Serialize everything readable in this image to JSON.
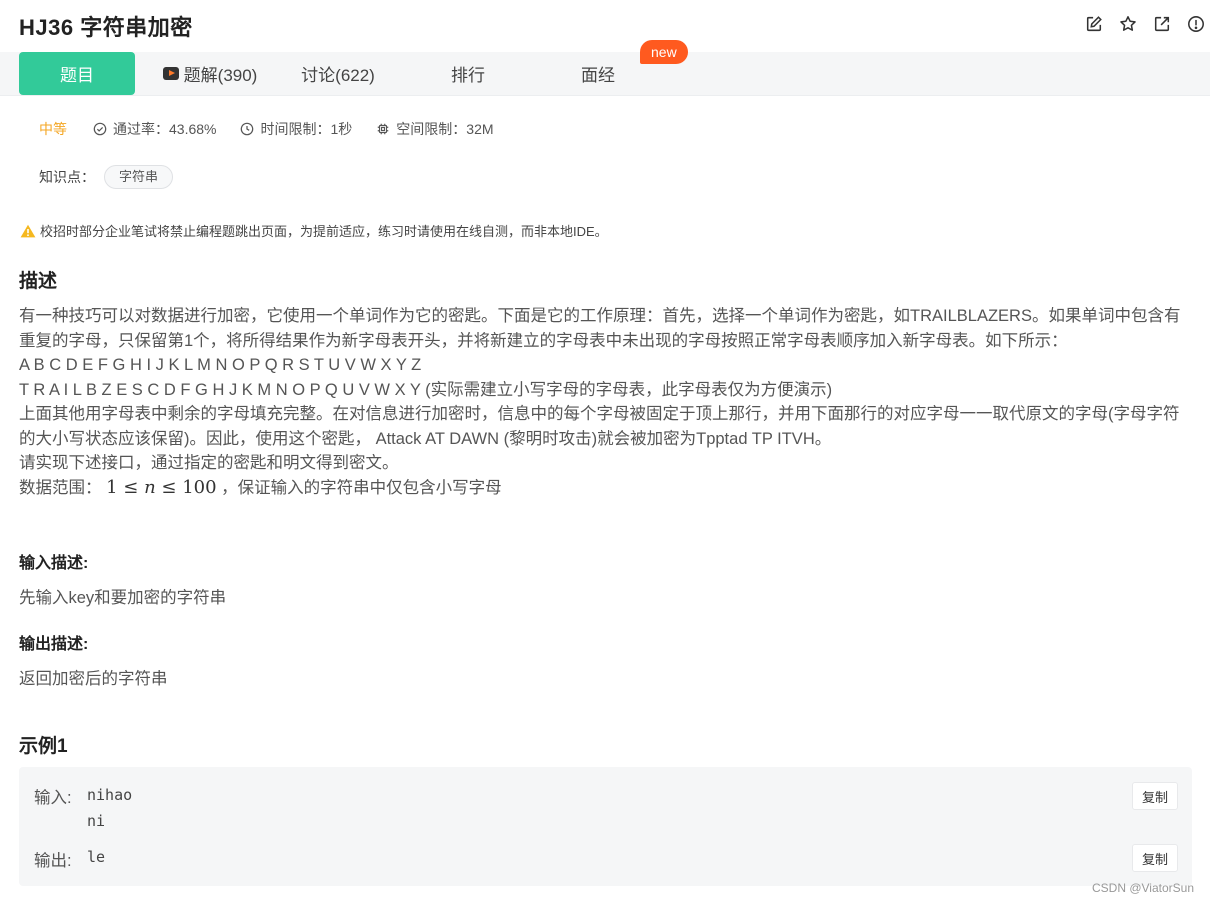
{
  "header": {
    "title": "HJ36  字符串加密"
  },
  "tabs": [
    {
      "label": "题目"
    },
    {
      "label": "题解(390)"
    },
    {
      "label": "讨论(622)"
    },
    {
      "label": "排行"
    },
    {
      "label": "面经"
    }
  ],
  "new_badge": "new",
  "meta": {
    "difficulty": "中等",
    "pass_rate": "通过率：43.68%",
    "time_limit": "时间限制：1秒",
    "space_limit": "空间限制：32M"
  },
  "knowledge": {
    "label": "知识点：",
    "tag": "字符串"
  },
  "warning": "校招时部分企业笔试将禁止编程题跳出页面，为提前适应，练习时请使用在线自测，而非本地IDE。",
  "description": {
    "heading": "描述",
    "para1": "有一种技巧可以对数据进行加密，它使用一个单词作为它的密匙。下面是它的工作原理：首先，选择一个单词作为密匙，如TRAILBLAZERS。如果单词中包含有重复的字母，只保留第1个，将所得结果作为新字母表开头，并将新建立的字母表中未出现的字母按照正常字母表顺序加入新字母表。如下所示：",
    "line_alphabet": "A B C D E F G H I J K L M N O P Q R S T U V W X Y Z",
    "line_cipher": "T R A I L B Z E S C D F G H J K M N O P Q U V W X Y (实际需建立小写字母的字母表，此字母表仅为方便演示)",
    "para2": "上面其他用字母表中剩余的字母填充完整。在对信息进行加密时，信息中的每个字母被固定于顶上那行，并用下面那行的对应字母一一取代原文的字母(字母字符的大小写状态应该保留)。因此，使用这个密匙， Attack AT DAWN (黎明时攻击)就会被加密为Tpptad TP ITVH。",
    "para3": "请实现下述接口，通过指定的密匙和明文得到密文。",
    "range_prefix": "数据范围：",
    "range_lower": "1",
    "range_var": "n",
    "range_upper": "100",
    "range_suffix": " ，保证输入的字符串中仅包含小写字母"
  },
  "input_desc": {
    "heading": "输入描述:",
    "text": "先输入key和要加密的字符串"
  },
  "output_desc": {
    "heading": "输出描述:",
    "text": "返回加密后的字符串"
  },
  "example": {
    "heading": "示例1",
    "input_label": "输入:",
    "input_line1": "nihao",
    "input_line2": "ni",
    "output_label": "输出:",
    "output_value": "le",
    "copy_label": "复制"
  },
  "watermark": "CSDN @ViatorSun",
  "colors": {
    "accent": "#32ca99",
    "difficulty": "#f4a623",
    "badge": "#ff5a1f"
  }
}
